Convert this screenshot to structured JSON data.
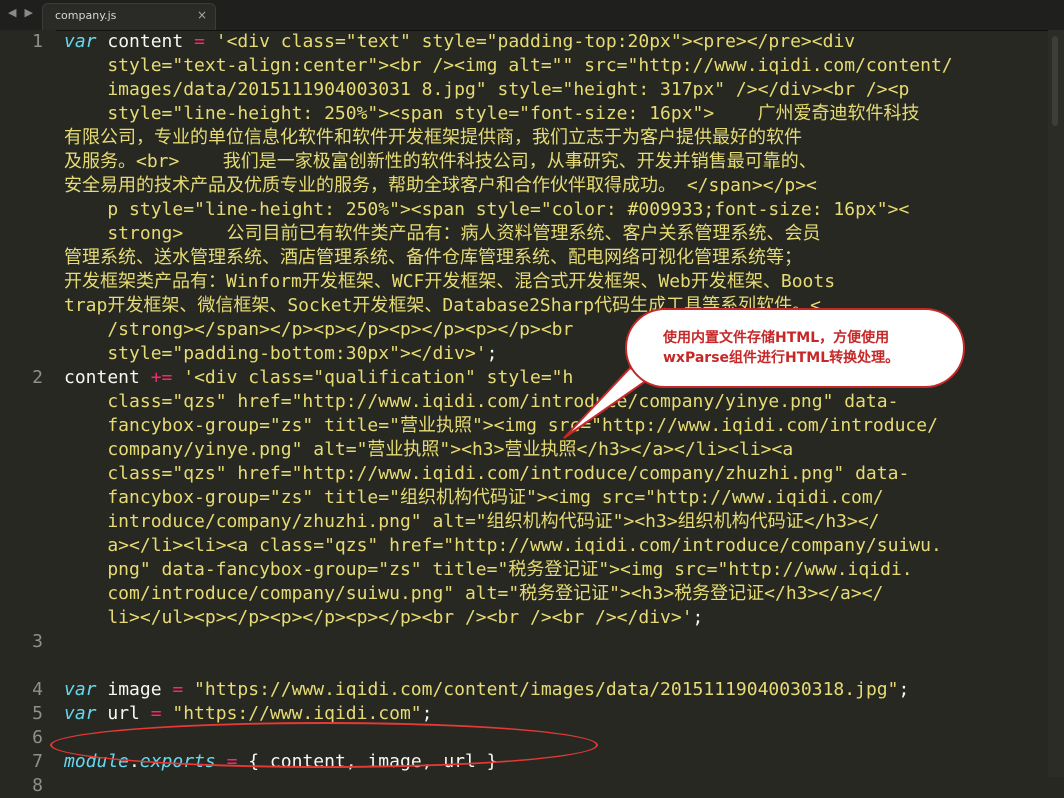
{
  "tab": {
    "label": "company.js",
    "close": "×"
  },
  "nav": {
    "back": "◀",
    "forward": "▶"
  },
  "line_numbers": [
    "1",
    "2",
    "3",
    "4",
    "5",
    "6",
    "7",
    "8"
  ],
  "code_rows": [
    [
      {
        "t": "kw",
        "v": "var"
      },
      {
        "t": "plain",
        "v": " content "
      },
      {
        "t": "op",
        "v": "="
      },
      {
        "t": "str",
        "v": " '<div class=\"text\" style=\"padding-top:20px\"><pre></pre><div"
      }
    ],
    [
      {
        "t": "str",
        "v": "    style=\"text-align:center\"><br /><img alt=\"\" src=\"http://www.iqidi.com/content/"
      }
    ],
    [
      {
        "t": "str",
        "v": "    images/data/2015111904003031 8.jpg\" style=\"height: 317px\" /></div><br /><p"
      }
    ],
    [
      {
        "t": "str",
        "v": "    style=\"line-height: 250%\"><span style=\"font-size: 16px\">    广州爱奇迪软件科技"
      }
    ],
    [
      {
        "t": "str",
        "v": "有限公司，专业的单位信息化软件和软件开发框架提供商，我们立志于为客户提供最好的软件"
      }
    ],
    [
      {
        "t": "str",
        "v": "及服务。<br>    我们是一家极富创新性的软件科技公司，从事研究、开发并销售最可靠的、"
      }
    ],
    [
      {
        "t": "str",
        "v": "安全易用的技术产品及优质专业的服务，帮助全球客户和合作伙伴取得成功。 </span></p><"
      }
    ],
    [
      {
        "t": "str",
        "v": "    p style=\"line-height: 250%\"><span style=\"color: #009933;font-size: 16px\"><"
      }
    ],
    [
      {
        "t": "str",
        "v": "    strong>    公司目前已有软件类产品有：病人资料管理系统、客户关系管理系统、会员"
      }
    ],
    [
      {
        "t": "str",
        "v": "管理系统、送水管理系统、酒店管理系统、备件仓库管理系统、配电网络可视化管理系统等；"
      }
    ],
    [
      {
        "t": "str",
        "v": "开发框架类产品有：Winform开发框架、WCF开发框架、混合式开发框架、Web开发框架、Boots"
      }
    ],
    [
      {
        "t": "str",
        "v": "trap开发框架、微信框架、Socket开发框架、Database2Sharp代码生成工具等系列软件。<"
      }
    ],
    [
      {
        "t": "str",
        "v": "    /strong></span></p><p></p><p></p><p></p><br"
      }
    ],
    [
      {
        "t": "str",
        "v": "    style=\"padding-bottom:30px\"></div>'"
      },
      {
        "t": "plain",
        "v": ";"
      }
    ],
    [
      {
        "t": "plain",
        "v": "content "
      },
      {
        "t": "op",
        "v": "+="
      },
      {
        "t": "str",
        "v": " '<div class=\"qualification\" style=\"h"
      }
    ],
    [
      {
        "t": "str",
        "v": "    class=\"qzs\" href=\"http://www.iqidi.com/introduce/company/yinye.png\" data-"
      }
    ],
    [
      {
        "t": "str",
        "v": "    fancybox-group=\"zs\" title=\"营业执照\"><img src=\"http://www.iqidi.com/introduce/"
      }
    ],
    [
      {
        "t": "str",
        "v": "    company/yinye.png\" alt=\"营业执照\"><h3>营业执照</h3></a></li><li><a"
      }
    ],
    [
      {
        "t": "str",
        "v": "    class=\"qzs\" href=\"http://www.iqidi.com/introduce/company/zhuzhi.png\" data-"
      }
    ],
    [
      {
        "t": "str",
        "v": "    fancybox-group=\"zs\" title=\"组织机构代码证\"><img src=\"http://www.iqidi.com/"
      }
    ],
    [
      {
        "t": "str",
        "v": "    introduce/company/zhuzhi.png\" alt=\"组织机构代码证\"><h3>组织机构代码证</h3></"
      }
    ],
    [
      {
        "t": "str",
        "v": "    a></li><li><a class=\"qzs\" href=\"http://www.iqidi.com/introduce/company/suiwu."
      }
    ],
    [
      {
        "t": "str",
        "v": "    png\" data-fancybox-group=\"zs\" title=\"税务登记证\"><img src=\"http://www.iqidi."
      }
    ],
    [
      {
        "t": "str",
        "v": "    com/introduce/company/suiwu.png\" alt=\"税务登记证\"><h3>税务登记证</h3></a></"
      }
    ],
    [
      {
        "t": "str",
        "v": "    li></ul><p></p><p></p><p></p><br /><br /><br /></div>'"
      },
      {
        "t": "plain",
        "v": ";"
      }
    ],
    [],
    [],
    [
      {
        "t": "kw",
        "v": "var"
      },
      {
        "t": "plain",
        "v": " image "
      },
      {
        "t": "op",
        "v": "="
      },
      {
        "t": "str",
        "v": " \"https://www.iqidi.com/content/images/data/20151119040030318.jpg\""
      },
      {
        "t": "plain",
        "v": ";"
      }
    ],
    [
      {
        "t": "kw",
        "v": "var"
      },
      {
        "t": "plain",
        "v": " url "
      },
      {
        "t": "op",
        "v": "="
      },
      {
        "t": "str",
        "v": " \"https://www.iqidi.com\""
      },
      {
        "t": "plain",
        "v": ";"
      }
    ],
    [],
    [
      {
        "t": "kw",
        "v": "module"
      },
      {
        "t": "plain",
        "v": "."
      },
      {
        "t": "kw",
        "v": "exports"
      },
      {
        "t": "plain",
        "v": " "
      },
      {
        "t": "op",
        "v": "="
      },
      {
        "t": "plain",
        "v": " { content, image, url }"
      }
    ],
    []
  ],
  "callout": {
    "text": "使用内置文件存储HTML，方便使用wxParse组件进行HTML转换处理。"
  },
  "colors": {
    "background": "#272822",
    "keyword": "#66d9ef",
    "operator": "#f92672",
    "string": "#e6db74",
    "annotation": "#c62828"
  }
}
